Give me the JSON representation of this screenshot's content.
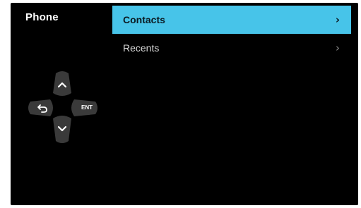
{
  "app": {
    "title": "Phone"
  },
  "menu": {
    "items": [
      {
        "label": "Contacts",
        "selected": true,
        "icon": "chevron-right-icon",
        "chevron": "›"
      },
      {
        "label": "Recents",
        "selected": false,
        "icon": "chevron-right-icon",
        "chevron": "›"
      }
    ]
  },
  "dpad": {
    "up_icon": "chevron-up-icon",
    "down_icon": "chevron-down-icon",
    "back_icon": "back-arrow-icon",
    "enter_label": "ENT"
  },
  "colors": {
    "background": "#000000",
    "selected": "#47c4e9",
    "dpad_button": "#3a3a3a",
    "text": "#ffffff"
  }
}
